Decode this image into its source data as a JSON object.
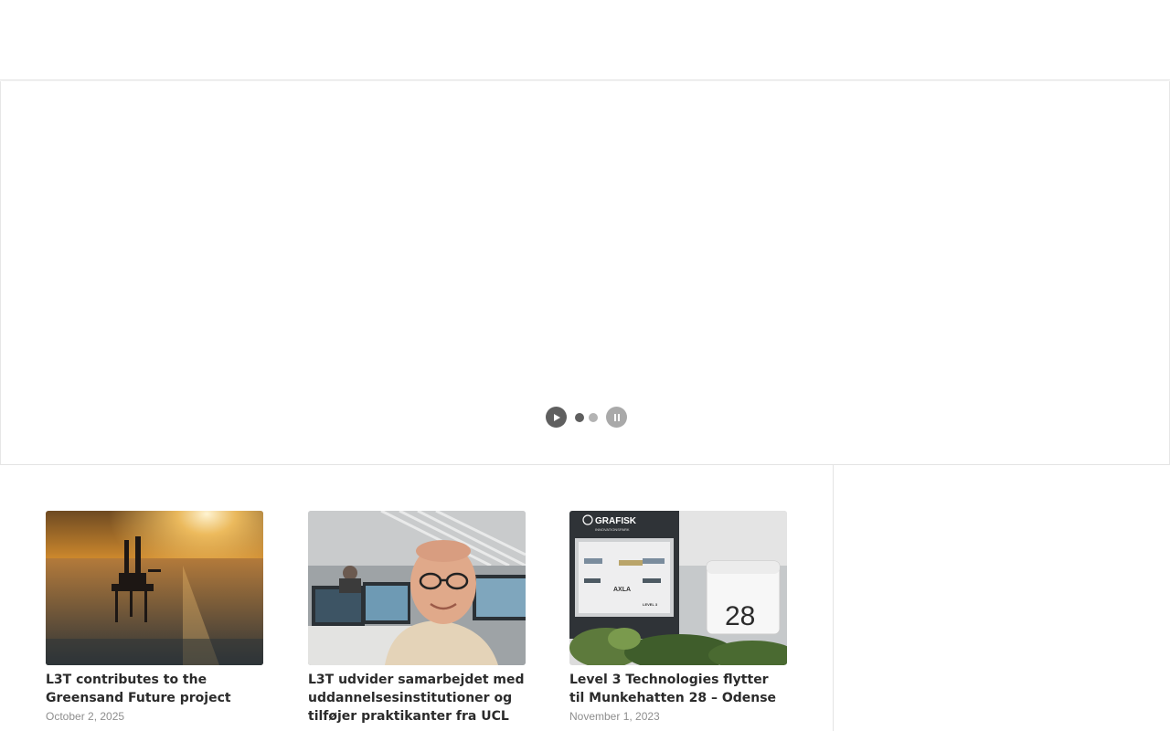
{
  "slider": {
    "play_icon": "play-icon",
    "pause_icon": "pause-icon",
    "dots": [
      {
        "state": "active"
      },
      {
        "state": "inactive"
      }
    ]
  },
  "posts": [
    {
      "title": "L3T contributes to the Greensand Future project",
      "date": "October 2, 2025",
      "image": "offshore-rig-sunset-photo"
    },
    {
      "title": "L3T udvider samarbejdet med uddannelsesinstitutioner og tilføjer praktikanter fra UCL",
      "date": "",
      "image": "smiling-man-office-photo"
    },
    {
      "title": "Level 3 Technologies flytter til Munkehatten 28 – Odense",
      "date": "November 1, 2023",
      "image": "office-building-sign-28-photo"
    }
  ],
  "image_text": {
    "building_brand": "GRAFISK",
    "building_sublabel": "INNOVATIONSPARK",
    "building_number": "28",
    "tenant_logos": [
      "AXLA",
      "LEVEL 3"
    ]
  },
  "colors": {
    "control_active": "#5f5f5f",
    "control_inactive": "#a9a9a9",
    "divider": "#e4e4e4",
    "title_text": "#2b2b2b",
    "date_text": "#8e8e8e"
  }
}
